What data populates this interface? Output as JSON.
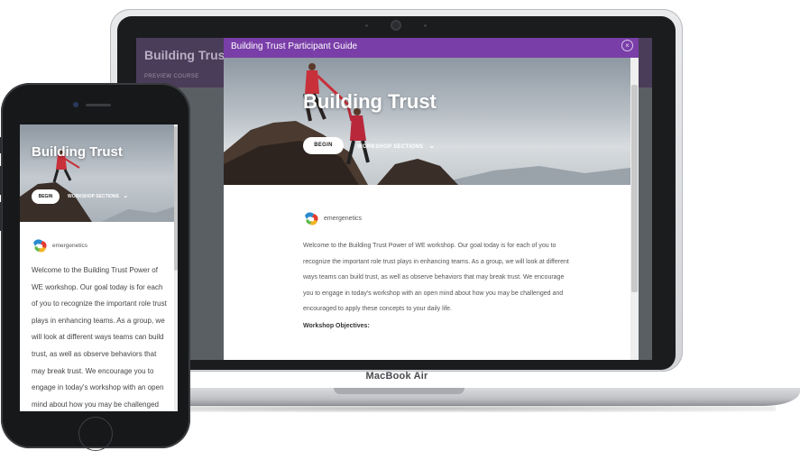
{
  "laptop": {
    "brand": "MacBook Air",
    "background_page": {
      "title": "Building Trust",
      "subtitle": "PREVIEW COURSE"
    },
    "modal": {
      "header_title": "Building Trust Participant Guide",
      "close_icon": "×",
      "hero_title": "Building Trust",
      "begin_label": "BEGIN",
      "sections_label": "WORKSHOP SECTIONS",
      "chevron": "⌄",
      "logo_text": "emergenetics",
      "intro": "Welcome to the Building Trust Power of WE workshop. Our goal today is for each of you to recognize the important role trust plays in enhancing teams. As a group, we will look at different ways teams can build trust, as well as observe behaviors that may break trust. We encourage you to engage in today's workshop with an open mind about how you may be challenged and encouraged to apply these concepts to your daily life.",
      "objectives_heading": "Workshop Objectives:"
    }
  },
  "phone": {
    "hero_title": "Building Trust",
    "begin_label": "BEGIN",
    "sections_label": "WORKSHOP SECTIONS",
    "chevron": "⌄",
    "logo_text": "emergenetics",
    "intro": "Welcome to the Building Trust Power of WE workshop. Our goal today is for each of you to recognize the important role trust plays in enhancing teams. As a group, we will look at different ways teams can build trust, as well as observe behaviors that may break trust. We encourage you to engage in today's workshop with an open mind about how you may be challenged and encouraged to apply these concepts to your daily life."
  },
  "colors": {
    "modal_header": "#7a3ea8",
    "background_header": "#4a3d5a",
    "text": "#555555"
  },
  "icons": {
    "close": "close-icon",
    "chevron": "chevron-down-icon",
    "logo": "emergenetics-logo-icon"
  }
}
